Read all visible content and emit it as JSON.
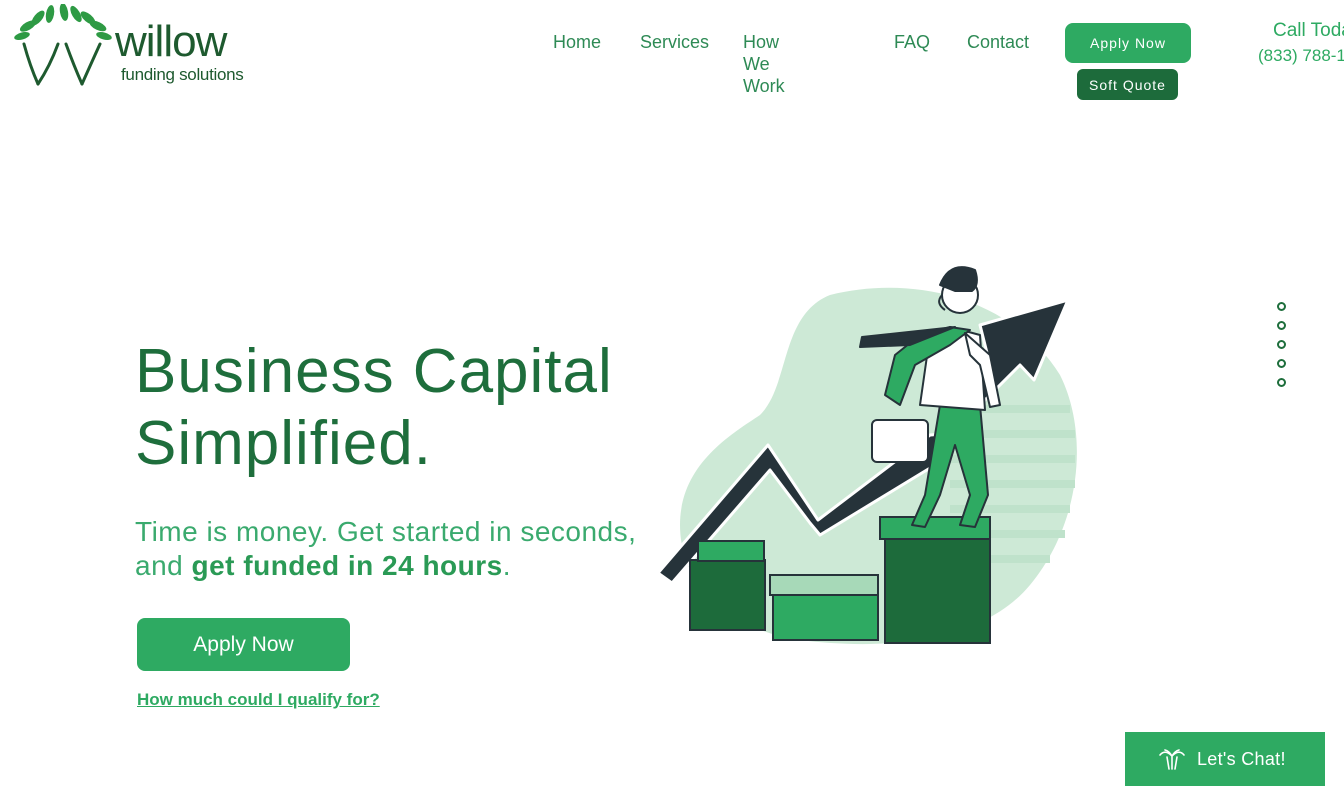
{
  "brand": {
    "name": "willow",
    "tagline": "funding solutions"
  },
  "nav": {
    "items": [
      {
        "label": "Home"
      },
      {
        "label": "Services"
      },
      {
        "label": "How We Work"
      },
      {
        "label": "FAQ"
      },
      {
        "label": "Contact"
      }
    ]
  },
  "header": {
    "apply_label": "Apply Now",
    "soft_quote_label": "Soft Quote",
    "call_label": "Call Today",
    "phone": "(833) 788-1"
  },
  "hero": {
    "title_line1": "Business Capital",
    "title_line2": "Simplified.",
    "subtitle_part1": "Time is money. Get started in seconds,",
    "subtitle_part2": "and ",
    "subtitle_strong": "get funded in 24 hours",
    "subtitle_end": ".",
    "apply_label": "Apply Now",
    "qualify_link": "How much could I qualify for?"
  },
  "section_nav": {
    "count": 5
  },
  "chat": {
    "label": "Let's Chat!",
    "icon": "palm-tree-icon"
  },
  "colors": {
    "primary": "#2eaa62",
    "dark_green": "#1e6e3c",
    "deep_green": "#1d6b3b",
    "illustration_dark": "#26333a"
  }
}
